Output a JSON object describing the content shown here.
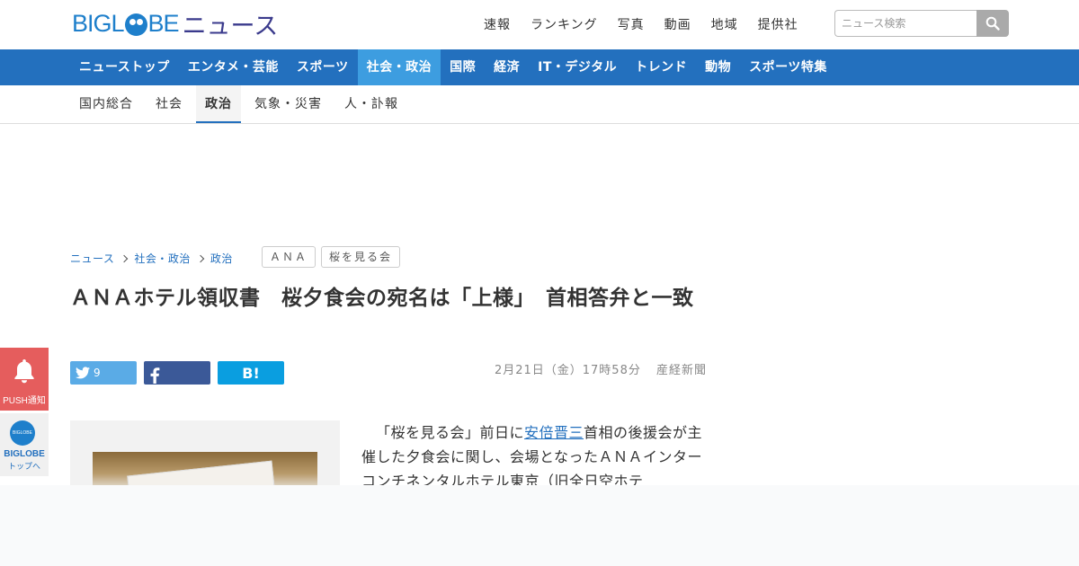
{
  "header": {
    "logo_text": "BIGLOBE",
    "logo_news": "ニュース",
    "top_nav": [
      "速報",
      "ランキング",
      "写真",
      "動画",
      "地域",
      "提供社"
    ],
    "search_placeholder": "ニュース検索"
  },
  "main_nav": {
    "items": [
      "ニューストップ",
      "エンタメ・芸能",
      "スポーツ",
      "社会・政治",
      "国際",
      "経済",
      "IT・デジタル",
      "トレンド",
      "動物",
      "スポーツ特集"
    ],
    "active": "社会・政治"
  },
  "sub_nav": {
    "items": [
      "国内総合",
      "社会",
      "政治",
      "気象・災害",
      "人・訃報"
    ],
    "active": "政治"
  },
  "breadcrumb": [
    "ニュース",
    "社会・政治",
    "政治"
  ],
  "tags": [
    "ＡＮＡ",
    "桜を見る会"
  ],
  "article": {
    "title": "ＡＮＡホテル領収書　桜夕食会の宛名は「上様」　首相答弁と一致",
    "date": "2月21日（金）17時58分",
    "source": "産経新聞",
    "body_pre": "「桜を見る会」前日に",
    "body_link": "安倍晋三",
    "body_post": "首相の後援会が主催した夕食会に関し、会場となったＡＮＡインターコンチネンタルホテル東京（旧全日空ホテ"
  },
  "share": {
    "twitter_count": "9",
    "hatena_label": "B!"
  },
  "side": {
    "push_label": "PUSH通知",
    "biglobe_small": "BIGLOBE",
    "biglobe_label": "BIGLOBE",
    "biglobe_sub": "トップへ"
  },
  "colors": {
    "brand_blue": "#2370be",
    "active_tab": "#3d9de0",
    "push_red": "#e55d5d"
  }
}
